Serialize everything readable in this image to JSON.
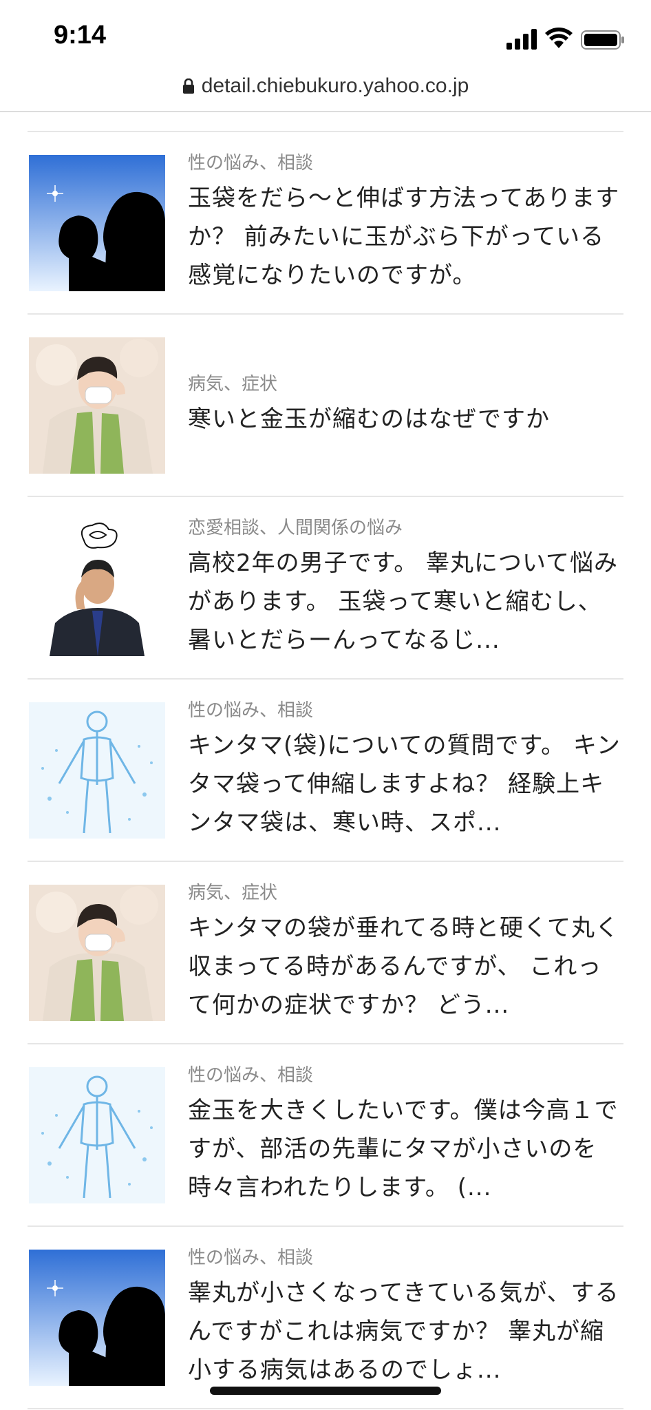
{
  "status_bar": {
    "time": "9:14",
    "icons": [
      "cellular-signal-icon",
      "wifi-icon",
      "battery-icon"
    ]
  },
  "browser": {
    "url": "detail.chiebukuro.yahoo.co.jp",
    "icon": "lock-icon"
  },
  "questions": [
    {
      "category": "性の悩み、相談",
      "title": "玉袋をだら〜と伸ばす方法ってありますか？ 前みたいに玉がぶら下がっている感覚になりたいのですが。",
      "thumbnail": "silhouette-couple-image"
    },
    {
      "category": "病気、症状",
      "title": "寒いと金玉が縮むのはなぜですか",
      "thumbnail": "woman-with-mask-image"
    },
    {
      "category": "恋愛相談、人間関係の悩み",
      "title": "高校2年の男子です。 睾丸について悩みがあります。 玉袋って寒いと縮むし、暑いとだらーんってなるじ...",
      "thumbnail": "worried-man-image"
    },
    {
      "category": "性の悩み、相談",
      "title": "キンタマ(袋)についての質問です。 キンタマ袋って伸縮しますよね？ 経験上キンタマ袋は、寒い時、スポ...",
      "thumbnail": "water-body-image"
    },
    {
      "category": "病気、症状",
      "title": "キンタマの袋が垂れてる時と硬くて丸く収まってる時があるんですが、 これって何かの症状ですか？ どう...",
      "thumbnail": "woman-with-mask-image"
    },
    {
      "category": "性の悩み、相談",
      "title": "金玉を大きくしたいです。僕は今高１ですが、部活の先輩にタマが小さいのを時々言われたりします。 (...",
      "thumbnail": "water-body-image"
    },
    {
      "category": "性の悩み、相談",
      "title": "睾丸が小さくなってきている気が、するんですがこれは病気ですか？ 睾丸が縮小する病気はあるのでしょ...",
      "thumbnail": "silhouette-couple-image"
    }
  ]
}
